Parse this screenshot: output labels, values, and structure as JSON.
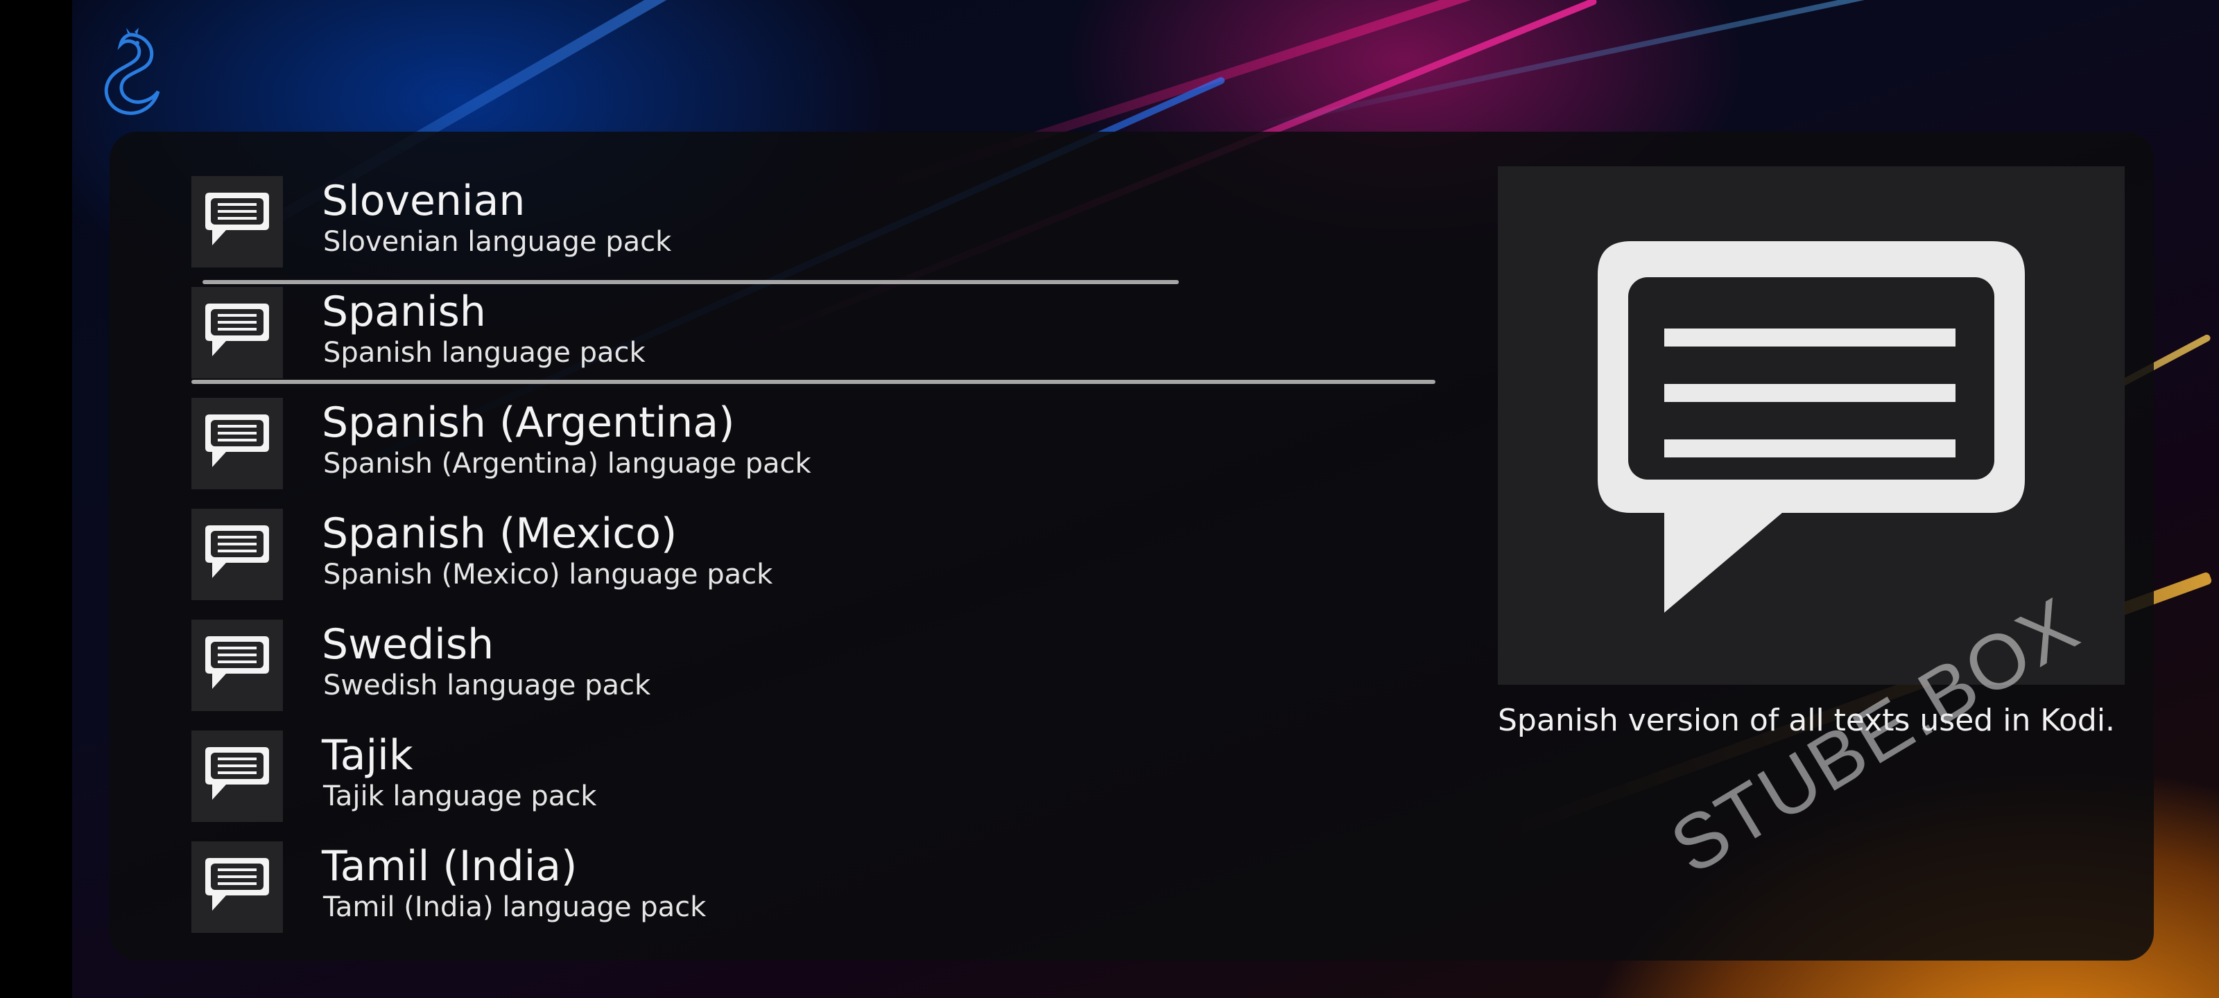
{
  "watermark": "STUBE.BOX",
  "logo_icon": "dragon-logo-icon",
  "list_icon": "chat-bubble-icon",
  "colors": {
    "accent_orange": "#ff9914",
    "accent_magenta": "#c81478",
    "accent_blue": "#0050dc",
    "panel_bg": "#0c0c0e",
    "icon_tile": "#242426"
  },
  "language_list": {
    "focused_index": 1,
    "items": [
      {
        "title": "Slovenian",
        "subtitle": "Slovenian language pack"
      },
      {
        "title": "Spanish",
        "subtitle": "Spanish language pack"
      },
      {
        "title": "Spanish (Argentina)",
        "subtitle": "Spanish (Argentina) language pack"
      },
      {
        "title": "Spanish (Mexico)",
        "subtitle": "Spanish (Mexico) language pack"
      },
      {
        "title": "Swedish",
        "subtitle": "Swedish language pack"
      },
      {
        "title": "Tajik",
        "subtitle": "Tajik language pack"
      },
      {
        "title": "Tamil (India)",
        "subtitle": "Tamil (India) language pack"
      }
    ]
  },
  "detail": {
    "description": "Spanish version of all texts used in Kodi."
  }
}
